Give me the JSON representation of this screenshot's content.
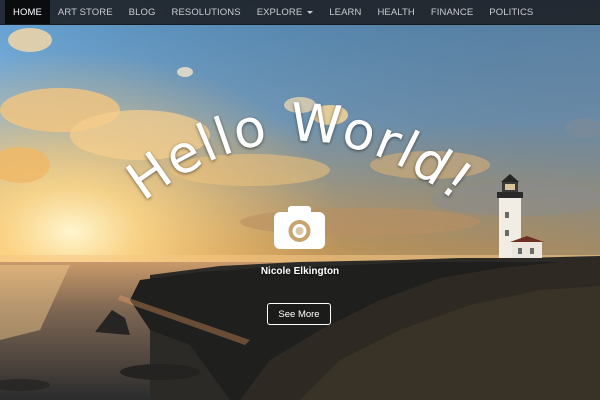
{
  "nav": {
    "items": [
      {
        "label": "HOME",
        "active": true
      },
      {
        "label": "ART STORE"
      },
      {
        "label": "BLOG"
      },
      {
        "label": "RESOLUTIONS"
      },
      {
        "label": "EXPLORE",
        "dropdown": true
      },
      {
        "label": "LEARN"
      },
      {
        "label": "HEALTH"
      },
      {
        "label": "FINANCE"
      },
      {
        "label": "POLITICS"
      }
    ]
  },
  "hero": {
    "headline": "Hello World!",
    "author": "Nicole Elkington",
    "cta_label": "See More",
    "icon": "camera-icon"
  },
  "colors": {
    "navbar_bg": "#1c1e22",
    "nav_active_bg": "#0b0c0e",
    "nav_text": "#c9cdd2",
    "headline": "#ffffff"
  }
}
